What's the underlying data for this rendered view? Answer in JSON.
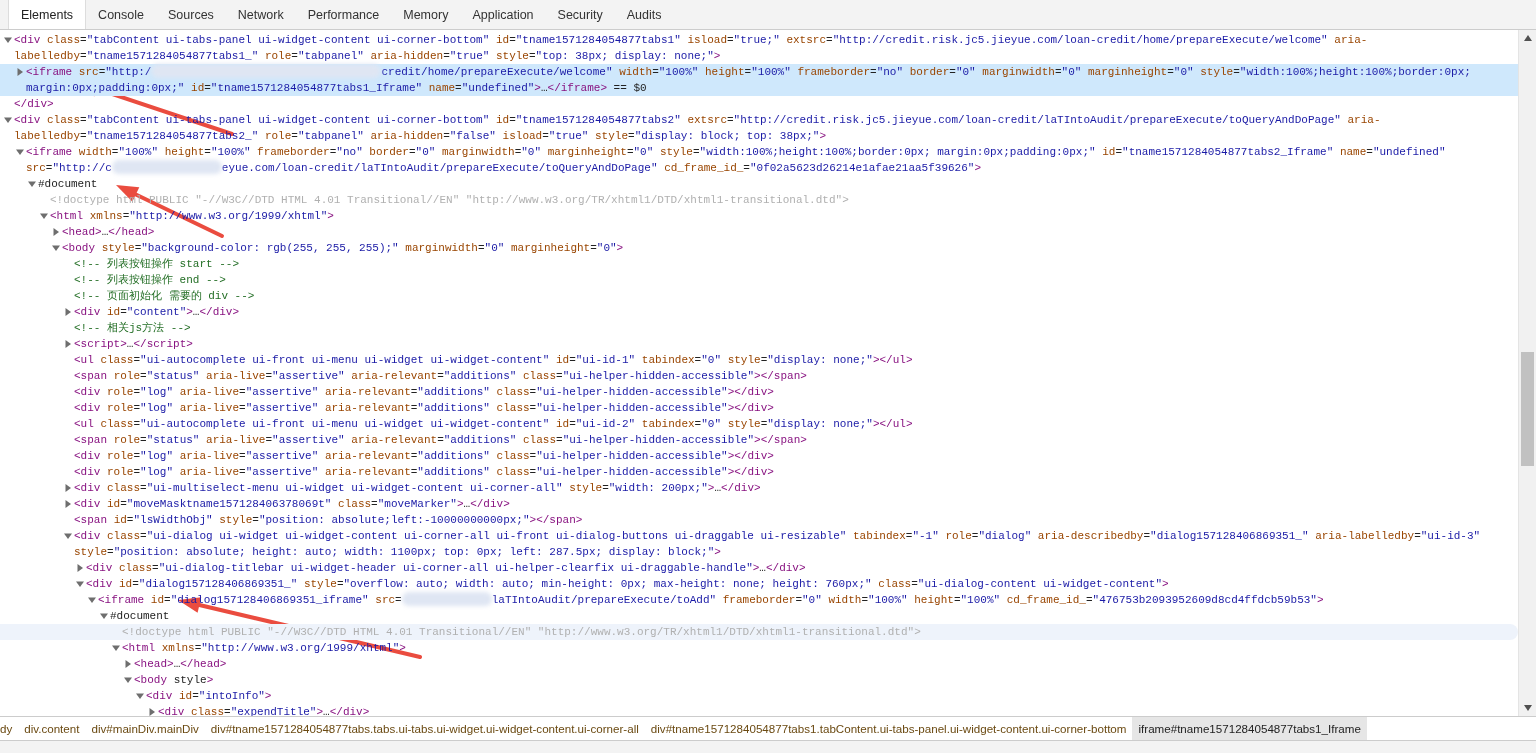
{
  "tabs": [
    {
      "label": "Elements",
      "selected": true
    },
    {
      "label": "Console",
      "selected": false
    },
    {
      "label": "Sources",
      "selected": false
    },
    {
      "label": "Network",
      "selected": false
    },
    {
      "label": "Performance",
      "selected": false
    },
    {
      "label": "Memory",
      "selected": false
    },
    {
      "label": "Application",
      "selected": false
    },
    {
      "label": "Security",
      "selected": false
    },
    {
      "label": "Audits",
      "selected": false
    }
  ],
  "tree": [
    {
      "kind": "element",
      "expanded": true,
      "selected": false,
      "hovered": false,
      "text": "<div class=\"tabContent ui-tabs-panel ui-widget-content ui-corner-bottom\" id=\"tname1571284054877tabs1\" isload=\"true;\" extsrc=\"http://credit.risk.jc5.jieyue.com/loan-credit/home/prepareExecute/welcome\" aria-labelledby=\"tname1571284054877tabs1_\" role=\"tabpanel\" aria-hidden=\"true\" style=\"top: 38px; display: none;\">",
      "closing": "</div>",
      "children": [
        {
          "kind": "element",
          "expanded": false,
          "selected": true,
          "hovered": false,
          "text": "<iframe src=\"http:/",
          "text_after_redaction": "credit/home/prepareExecute/welcome\" width=\"100%\" height=\"100%\" frameborder=\"no\" border=\"0\" marginwidth=\"0\" marginheight=\"0\" style=\"width:100%;height:100%;border:0px; margin:0px;padding:0px;\" id=\"tname1571284054877tabs1_Iframe\" name=\"undefined\">…</iframe> == $0"
        }
      ]
    },
    {
      "kind": "element",
      "expanded": true,
      "selected": false,
      "hovered": false,
      "text": "<div class=\"tabContent ui-tabs-panel ui-widget-content ui-corner-bottom\" id=\"tname1571284054877tabs2\" extsrc=\"http://credit.risk.jc5.jieyue.com/loan-credit/laTIntoAudit/prepareExecute/toQueryAndDoPage\" aria-labelledby=\"tname1571284054877tabs2_\" role=\"tabpanel\" aria-hidden=\"false\" isload=\"true\" style=\"display: block; top: 38px;\">",
      "children": [
        {
          "kind": "element",
          "expanded": true,
          "selected": false,
          "hovered": false,
          "text": "<iframe width=\"100%\" height=\"100%\" frameborder=\"no\" border=\"0\" marginwidth=\"0\" marginheight=\"0\" style=\"width:100%;height:100%;border:0px; margin:0px;padding:0px;\" id=\"tname1571284054877tabs2_Iframe\" name=\"undefined\" src=\"http://c",
          "text_after_redaction": "eyue.com/loan-credit/laTIntoAudit/prepareExecute/toQueryAndDoPage\" cd_frame_id_=\"0f02a5623d26214e1afae21aa5f39626\">",
          "children": [
            {
              "kind": "document",
              "expanded": true,
              "selected": false,
              "hovered": false,
              "text": "#document",
              "children": [
                {
                  "kind": "doctype",
                  "selected": false,
                  "hovered": false,
                  "text": "<!doctype html PUBLIC \"-//W3C//DTD HTML 4.01 Transitional//EN\" \"http://www.w3.org/TR/xhtml1/DTD/xhtml1-transitional.dtd\">"
                },
                {
                  "kind": "element",
                  "expanded": true,
                  "selected": false,
                  "hovered": false,
                  "text": "<html xmlns=\"http://www.w3.org/1999/xhtml\">",
                  "children": [
                    {
                      "kind": "element",
                      "expanded": false,
                      "selected": false,
                      "hovered": false,
                      "text": "<head>…</head>"
                    },
                    {
                      "kind": "element",
                      "expanded": true,
                      "selected": false,
                      "hovered": false,
                      "text": "<body style=\"background-color: rgb(255, 255, 255);\" marginwidth=\"0\" marginheight=\"0\">",
                      "children": [
                        {
                          "kind": "comment",
                          "selected": false,
                          "hovered": false,
                          "text": "<!-- 列表按钮操作 start -->"
                        },
                        {
                          "kind": "comment",
                          "selected": false,
                          "hovered": false,
                          "text": "<!-- 列表按钮操作 end -->"
                        },
                        {
                          "kind": "comment",
                          "selected": false,
                          "hovered": false,
                          "text": "<!-- 页面初始化 需要的 div -->"
                        },
                        {
                          "kind": "element",
                          "expanded": false,
                          "selected": false,
                          "hovered": false,
                          "text": "<div id=\"content\">…</div>"
                        },
                        {
                          "kind": "comment",
                          "selected": false,
                          "hovered": false,
                          "text": "<!-- 相关js方法 -->"
                        },
                        {
                          "kind": "element",
                          "expanded": false,
                          "selected": false,
                          "hovered": false,
                          "text": "<script>…</script>"
                        },
                        {
                          "kind": "element",
                          "selected": false,
                          "hovered": false,
                          "text": "<ul class=\"ui-autocomplete ui-front ui-menu ui-widget ui-widget-content\" id=\"ui-id-1\" tabindex=\"0\" style=\"display: none;\"></ul>"
                        },
                        {
                          "kind": "element",
                          "selected": false,
                          "hovered": false,
                          "text": "<span role=\"status\" aria-live=\"assertive\" aria-relevant=\"additions\" class=\"ui-helper-hidden-accessible\"></span>"
                        },
                        {
                          "kind": "element",
                          "selected": false,
                          "hovered": false,
                          "text": "<div role=\"log\" aria-live=\"assertive\" aria-relevant=\"additions\" class=\"ui-helper-hidden-accessible\"></div>"
                        },
                        {
                          "kind": "element",
                          "selected": false,
                          "hovered": false,
                          "text": "<div role=\"log\" aria-live=\"assertive\" aria-relevant=\"additions\" class=\"ui-helper-hidden-accessible\"></div>"
                        },
                        {
                          "kind": "element",
                          "selected": false,
                          "hovered": false,
                          "text": "<ul class=\"ui-autocomplete ui-front ui-menu ui-widget ui-widget-content\" id=\"ui-id-2\" tabindex=\"0\" style=\"display: none;\"></ul>"
                        },
                        {
                          "kind": "element",
                          "selected": false,
                          "hovered": false,
                          "text": "<span role=\"status\" aria-live=\"assertive\" aria-relevant=\"additions\" class=\"ui-helper-hidden-accessible\"></span>"
                        },
                        {
                          "kind": "element",
                          "selected": false,
                          "hovered": false,
                          "text": "<div role=\"log\" aria-live=\"assertive\" aria-relevant=\"additions\" class=\"ui-helper-hidden-accessible\"></div>"
                        },
                        {
                          "kind": "element",
                          "selected": false,
                          "hovered": false,
                          "text": "<div role=\"log\" aria-live=\"assertive\" aria-relevant=\"additions\" class=\"ui-helper-hidden-accessible\"></div>"
                        },
                        {
                          "kind": "element",
                          "expanded": false,
                          "selected": false,
                          "hovered": false,
                          "text": "<div class=\"ui-multiselect-menu ui-widget ui-widget-content ui-corner-all\" style=\"width: 200px;\">…</div>"
                        },
                        {
                          "kind": "element",
                          "expanded": false,
                          "selected": false,
                          "hovered": false,
                          "text": "<div id=\"moveMasktname157128406378069t\" class=\"moveMarker\">…</div>"
                        },
                        {
                          "kind": "element",
                          "selected": false,
                          "hovered": false,
                          "text": "<span id=\"lsWidthObj\" style=\"position: absolute;left:-10000000000px;\"></span>"
                        },
                        {
                          "kind": "element",
                          "expanded": true,
                          "selected": false,
                          "hovered": false,
                          "text": "<div class=\"ui-dialog ui-widget ui-widget-content ui-corner-all ui-front ui-dialog-buttons ui-draggable ui-resizable\" tabindex=\"-1\" role=\"dialog\" aria-describedby=\"dialog157128406869351_\" aria-labelledby=\"ui-id-3\" style=\"position: absolute; height: auto; width: 1100px; top: 0px; left: 287.5px; display: block;\">",
                          "children": [
                            {
                              "kind": "element",
                              "expanded": false,
                              "selected": false,
                              "hovered": false,
                              "text": "<div class=\"ui-dialog-titlebar ui-widget-header ui-corner-all ui-helper-clearfix ui-draggable-handle\">…</div>"
                            },
                            {
                              "kind": "element",
                              "expanded": true,
                              "selected": false,
                              "hovered": false,
                              "text": "<div id=\"dialog157128406869351_\" style=\"overflow: auto; width: auto; min-height: 0px; max-height: none; height: 760px;\" class=\"ui-dialog-content ui-widget-content\">",
                              "children": [
                                {
                                  "kind": "element",
                                  "expanded": true,
                                  "selected": false,
                                  "hovered": false,
                                  "text": "<iframe id=\"dialog157128406869351_iframe\" src=",
                                  "text_after_redaction": "laTIntoAudit/prepareExecute/toAdd\" frameborder=\"0\" width=\"100%\" height=\"100%\" cd_frame_id_=\"476753b2093952609d8cd4ffdcb59b53\">",
                                  "children": [
                                    {
                                      "kind": "document",
                                      "expanded": true,
                                      "selected": false,
                                      "hovered": false,
                                      "text": "#document",
                                      "children": [
                                        {
                                          "kind": "doctype",
                                          "selected": false,
                                          "hovered": true,
                                          "text": "<!doctype html PUBLIC \"-//W3C//DTD HTML 4.01 Transitional//EN\" \"http://www.w3.org/TR/xhtml1/DTD/xhtml1-transitional.dtd\">"
                                        },
                                        {
                                          "kind": "element",
                                          "expanded": true,
                                          "selected": false,
                                          "hovered": false,
                                          "text": "<html xmlns=\"http://www.w3.org/1999/xhtml\">",
                                          "children": [
                                            {
                                              "kind": "element",
                                              "expanded": false,
                                              "selected": false,
                                              "hovered": false,
                                              "text": "<head>…</head>"
                                            },
                                            {
                                              "kind": "element",
                                              "expanded": true,
                                              "selected": false,
                                              "hovered": false,
                                              "text": "<body style>",
                                              "children": [
                                                {
                                                  "kind": "element",
                                                  "expanded": true,
                                                  "selected": false,
                                                  "hovered": false,
                                                  "text": "<div id=\"intoInfo\">",
                                                  "children": [
                                                    {
                                                      "kind": "element",
                                                      "expanded": false,
                                                      "selected": false,
                                                      "hovered": false,
                                                      "text": "<div class=\"expendTitle\">…</div>"
                                                    }
                                                  ]
                                                }
                                              ]
                                            }
                                          ]
                                        }
                                      ]
                                    }
                                  ]
                                }
                              ]
                            }
                          ]
                        }
                      ]
                    }
                  ]
                }
              ]
            }
          ]
        }
      ]
    }
  ],
  "breadcrumbs": [
    {
      "label": "dy",
      "selected": false
    },
    {
      "label": "div.content",
      "selected": false
    },
    {
      "label": "div#mainDiv.mainDiv",
      "selected": false
    },
    {
      "label": "div#tname1571284054877tabs.tabs.ui-tabs.ui-widget.ui-widget-content.ui-corner-all",
      "selected": false
    },
    {
      "label": "div#tname1571284054877tabs1.tabContent.ui-tabs-panel.ui-widget-content.ui-corner-bottom",
      "selected": false
    },
    {
      "label": "iframe#tname1571284054877tabs1_Iframe",
      "selected": true
    }
  ]
}
